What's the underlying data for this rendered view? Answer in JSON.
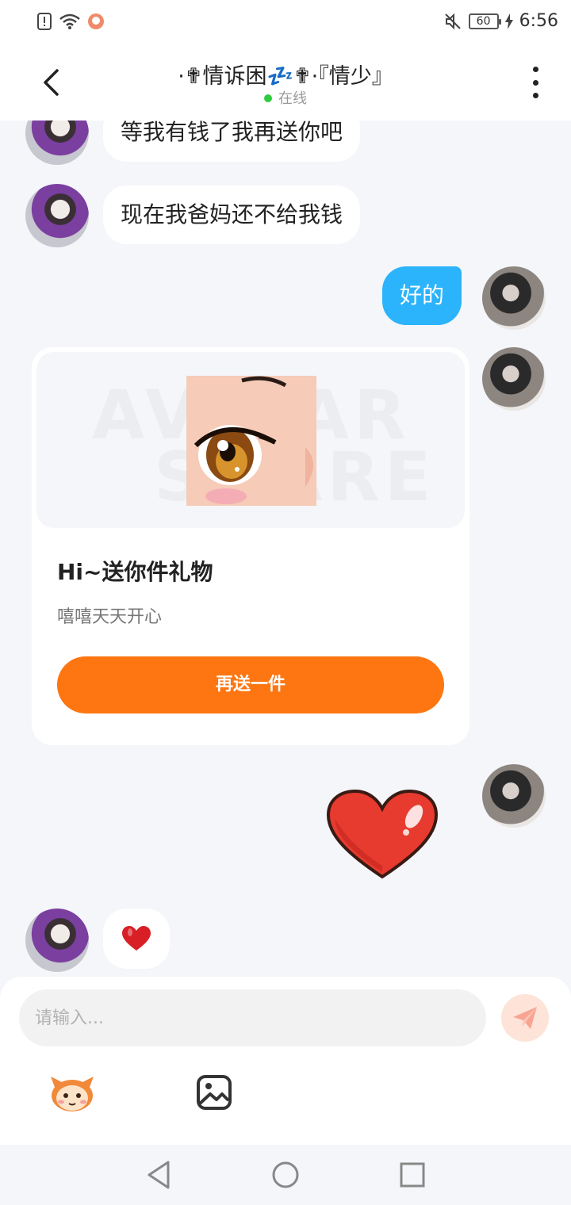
{
  "status_bar": {
    "battery": "60",
    "time": "6:56"
  },
  "header": {
    "title": "·✟情诉困💤✟·『情少』",
    "status": "在线"
  },
  "messages": [
    {
      "side": "left",
      "text": "等我有钱了我再送你吧"
    },
    {
      "side": "left",
      "text": "现在我爸妈还不给我钱"
    },
    {
      "side": "right",
      "text": "好的"
    }
  ],
  "gift_card": {
    "watermark_line1": "AVATAR",
    "watermark_line2": "SHARE",
    "title": "Hi~送你件礼物",
    "subtitle": "嘻嘻天天开心",
    "button_label": "再送一件"
  },
  "input": {
    "placeholder": "请输入..."
  },
  "colors": {
    "accent_blue": "#2bb3fb",
    "accent_orange": "#fd7612",
    "online_green": "#2ecc40"
  }
}
